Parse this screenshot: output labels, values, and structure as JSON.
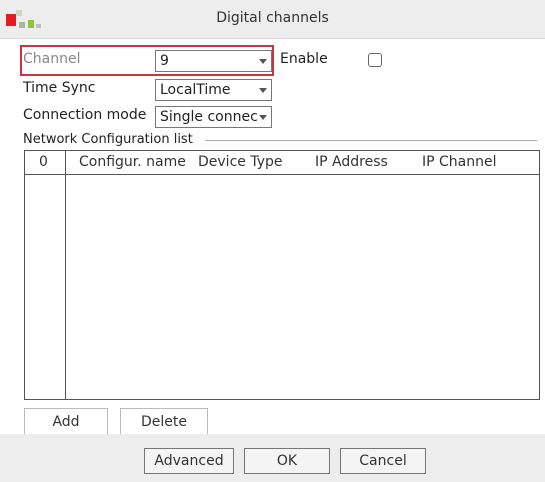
{
  "window": {
    "title": "Digital channels"
  },
  "channel": {
    "label": "Channel",
    "value": "9"
  },
  "enable": {
    "label": "Enable",
    "checked": false
  },
  "time_sync": {
    "label": "Time Sync",
    "value": "LocalTime"
  },
  "connection_mode": {
    "label": "Connection mode",
    "value": "Single connec"
  },
  "network_config": {
    "group_label": "Network Configuration list",
    "columns": [
      "0",
      "Configur. name",
      "Device Type",
      "IP Address",
      "IP Channel"
    ],
    "rows": []
  },
  "table_actions": {
    "add": "Add",
    "delete": "Delete"
  },
  "footer": {
    "advanced": "Advanced",
    "ok": "OK",
    "cancel": "Cancel"
  },
  "colors": {
    "highlight_border": "#c7353f",
    "logo_red": "#e21c23",
    "logo_green": "#8cc63f"
  }
}
